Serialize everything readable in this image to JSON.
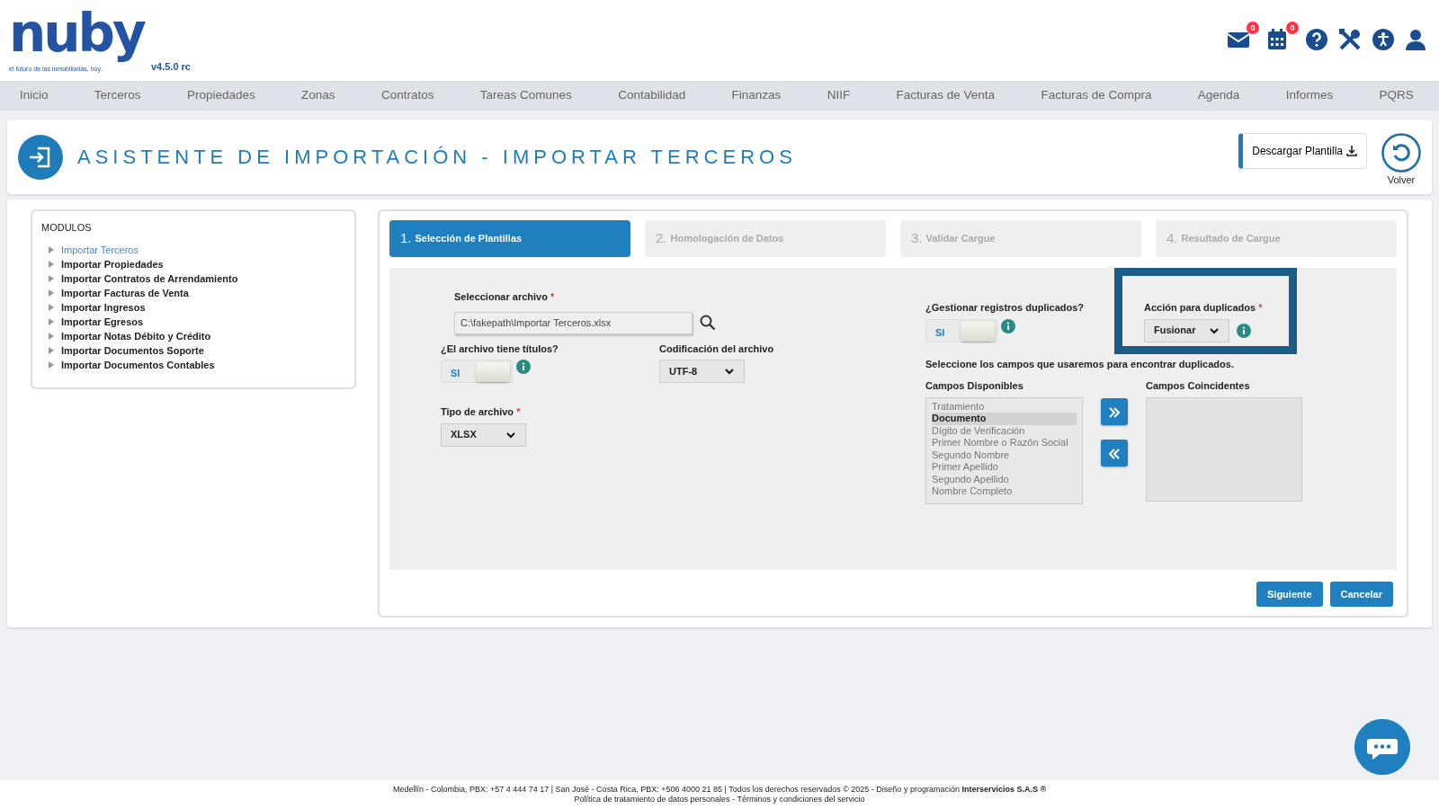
{
  "header": {
    "logo": "nuby",
    "tagline": "el futuro de las inmobiliarias, hoy.",
    "version": "v4.5.0 rc",
    "mail_badge": "0",
    "calendar_badge": "0"
  },
  "nav": [
    "Inicio",
    "Terceros",
    "Propiedades",
    "Zonas",
    "Contratos",
    "Tareas Comunes",
    "Contabilidad",
    "Finanzas",
    "NIIF",
    "Facturas de Venta",
    "Facturas de Compra",
    "Agenda",
    "Informes",
    "PQRS"
  ],
  "page_title": "ASISTENTE DE IMPORTACIÓN - IMPORTAR TERCEROS",
  "download_button": "Descargar Plantilla",
  "back_button": "Volver",
  "modules": {
    "title": "MODULOS",
    "items": [
      {
        "label": "Importar Terceros",
        "selected": true
      },
      {
        "label": "Importar Propiedades",
        "selected": false
      },
      {
        "label": "Importar Contratos de Arrendamiento",
        "selected": false
      },
      {
        "label": "Importar Facturas de Venta",
        "selected": false
      },
      {
        "label": "Importar Ingresos",
        "selected": false
      },
      {
        "label": "Importar Egresos",
        "selected": false
      },
      {
        "label": "Importar Notas Débito y Crédito",
        "selected": false
      },
      {
        "label": "Importar Documentos Soporte",
        "selected": false
      },
      {
        "label": "Importar Documentos Contables",
        "selected": false
      }
    ]
  },
  "steps": [
    {
      "number": "1.",
      "label": "Selección de Plantillas",
      "selected": true
    },
    {
      "number": "2.",
      "label": "Homologación de Datos",
      "selected": false
    },
    {
      "number": "3.",
      "label": "Validar Cargue",
      "selected": false
    },
    {
      "number": "4.",
      "label": "Resultado de Cargue",
      "selected": false
    }
  ],
  "form": {
    "file": {
      "label": "Seleccionar archivo",
      "required_mark": "*",
      "value": "C:\\fakepath\\Importar Terceros.xlsx"
    },
    "has_titles": {
      "label": "¿El archivo tiene títulos?",
      "on": true,
      "on_label": "SI"
    },
    "encoding": {
      "label": "Codificación del archivo",
      "value": "UTF-8"
    },
    "file_type": {
      "label": "Tipo de archivo",
      "required_mark": "*",
      "value": "XLSX"
    },
    "duplicates": {
      "label": "¿Gestionar registros duplicados?",
      "on": true,
      "on_label": "SI"
    },
    "action": {
      "label": "Acción para duplicados",
      "required_mark": "*",
      "value": "Fusionar"
    },
    "hint": "Seleccione los campos que usaremos para encontrar duplicados.",
    "available": {
      "label": "Campos Disponibles",
      "items": [
        {
          "label": "Tratamiento",
          "selected": false
        },
        {
          "label": "Documento",
          "selected": true
        },
        {
          "label": "Dígito de Verificación",
          "selected": false
        },
        {
          "label": "Primer Nombre o Razón Social",
          "selected": false
        },
        {
          "label": "Segundo Nombre",
          "selected": false
        },
        {
          "label": "Primer Apellido",
          "selected": false
        },
        {
          "label": "Segundo Apellido",
          "selected": false
        },
        {
          "label": "Nombre Completo",
          "selected": false
        }
      ]
    },
    "matching": {
      "label": "Campos Coincidentes"
    },
    "buttons": [
      "Siguiente",
      "Cancelar"
    ]
  },
  "footer": [
    "Medellín - Colombia, PBX: +57 4 444 74 17 | San José - Costa Rica, PBX: +506 4000 21 85 | Todos los derechos reservados © 2025 - Diseño y programación **Interservicios S.A.S ®**",
    "Política de tratamiento de datos personales - Términos y condiciones del servicio"
  ]
}
